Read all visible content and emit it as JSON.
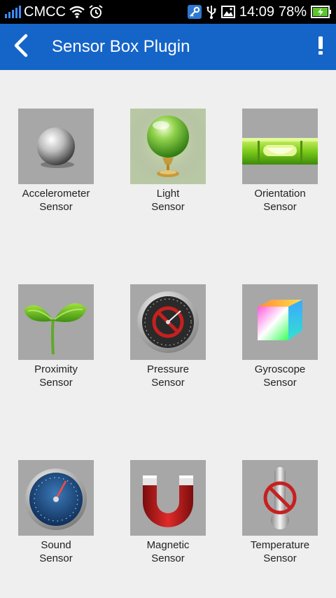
{
  "status_bar": {
    "carrier": "CMCC",
    "time": "14:09",
    "battery": "78%"
  },
  "app_bar": {
    "title": "Sensor Box Plugin"
  },
  "sensors": [
    {
      "line1": "Accelerometer",
      "line2": "Sensor",
      "icon": "sphere-icon"
    },
    {
      "line1": "Light",
      "line2": "Sensor",
      "icon": "crystal-ball-icon"
    },
    {
      "line1": "Orientation",
      "line2": "Sensor",
      "icon": "spirit-level-icon"
    },
    {
      "line1": "Proximity",
      "line2": "Sensor",
      "icon": "sprout-icon"
    },
    {
      "line1": "Pressure",
      "line2": "Sensor",
      "icon": "pressure-gauge-icon"
    },
    {
      "line1": "Gyroscope",
      "line2": "Sensor",
      "icon": "color-cube-icon"
    },
    {
      "line1": "Sound",
      "line2": "Sensor",
      "icon": "sound-meter-icon"
    },
    {
      "line1": "Magnetic",
      "line2": "Sensor",
      "icon": "magnet-icon"
    },
    {
      "line1": "Temperature",
      "line2": "Sensor",
      "icon": "thermometer-icon"
    }
  ]
}
